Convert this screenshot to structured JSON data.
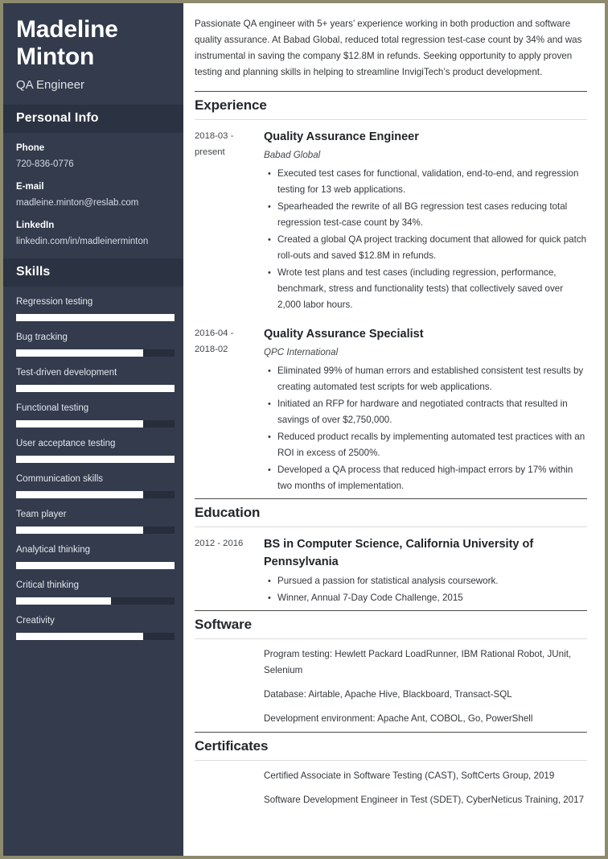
{
  "theme": {
    "sidebar_bg": "#333b4d",
    "sidebar_head_bg": "#2b3242",
    "bar_track": "#272d3b",
    "bar_fill": "#ffffff",
    "page_border": "#8d8a6e",
    "rule_dark": "#4a4a4a",
    "rule_light": "#dcdcdc"
  },
  "sidebar": {
    "full_name": "Madeline Minton",
    "job_title": "QA Engineer",
    "personal_info": {
      "heading": "Personal Info",
      "items": [
        {
          "label": "Phone",
          "value": "720-836-0776"
        },
        {
          "label": "E-mail",
          "value": "madleine.minton@reslab.com"
        },
        {
          "label": "LinkedIn",
          "value": "linkedin.com/in/madleinerminton"
        }
      ]
    },
    "skills": {
      "heading": "Skills",
      "items": [
        {
          "label": "Regression testing",
          "level": 100
        },
        {
          "label": "Bug tracking",
          "level": 80
        },
        {
          "label": "Test-driven development",
          "level": 100
        },
        {
          "label": "Functional testing",
          "level": 80
        },
        {
          "label": "User acceptance testing",
          "level": 100
        },
        {
          "label": "Communication skills",
          "level": 80
        },
        {
          "label": "Team player",
          "level": 80
        },
        {
          "label": "Analytical thinking",
          "level": 100
        },
        {
          "label": "Critical thinking",
          "level": 60
        },
        {
          "label": "Creativity",
          "level": 80
        }
      ]
    }
  },
  "main": {
    "summary": "Passionate QA engineer with 5+ years’ experience working in both production and software quality assurance. At Babad Global, reduced total regression test-case count by 34% and was instrumental in saving the company $12.8M in refunds. Seeking opportunity to apply proven testing and planning skills in helping to streamline InvigiTech’s product development.",
    "experience": {
      "heading": "Experience",
      "entries": [
        {
          "date": "2018-03 - present",
          "role": "Quality Assurance Engineer",
          "org": "Babad Global",
          "bullets": [
            "Executed test cases for functional, validation, end-to-end, and regression testing for 13 web applications.",
            "Spearheaded the rewrite of all BG regression test cases reducing total regression test-case count by 34%.",
            "Created a global QA project tracking document that allowed for quick patch roll-outs and saved $12.8M in refunds.",
            "Wrote test plans and test cases (including regression, performance, benchmark, stress and functionality tests) that collectively saved over 2,000 labor hours."
          ]
        },
        {
          "date": "2016-04 - 2018-02",
          "role": "Quality Assurance Specialist",
          "org": "QPC International",
          "bullets": [
            "Eliminated 99% of human errors and established consistent test results by creating automated test scripts for web applications.",
            "Initiated an RFP for hardware and negotiated contracts that resulted in savings of over $2,750,000.",
            "Reduced product recalls by implementing automated test practices with an ROI in excess of 2500%.",
            "Developed a QA process that reduced high-impact errors by 17% within two months of implementation."
          ]
        }
      ]
    },
    "education": {
      "heading": "Education",
      "entries": [
        {
          "date": "2012 - 2016",
          "role": "BS in Computer Science, California University of Pennsylvania",
          "org": "",
          "bullets": [
            "Pursued a passion for statistical analysis coursework.",
            "Winner, Annual 7-Day Code Challenge, 2015"
          ]
        }
      ]
    },
    "software": {
      "heading": "Software",
      "lines": [
        "Program testing: Hewlett Packard LoadRunner, IBM Rational Robot, JUnit, Selenium",
        "Database: Airtable, Apache Hive, Blackboard, Transact-SQL",
        "Development environment: Apache Ant, COBOL, Go, PowerShell"
      ]
    },
    "certificates": {
      "heading": "Certificates",
      "lines": [
        "Certified Associate in Software Testing (CAST), SoftCerts Group, 2019",
        "Software Development Engineer in Test (SDET), CyberNeticus Training, 2017"
      ]
    }
  }
}
